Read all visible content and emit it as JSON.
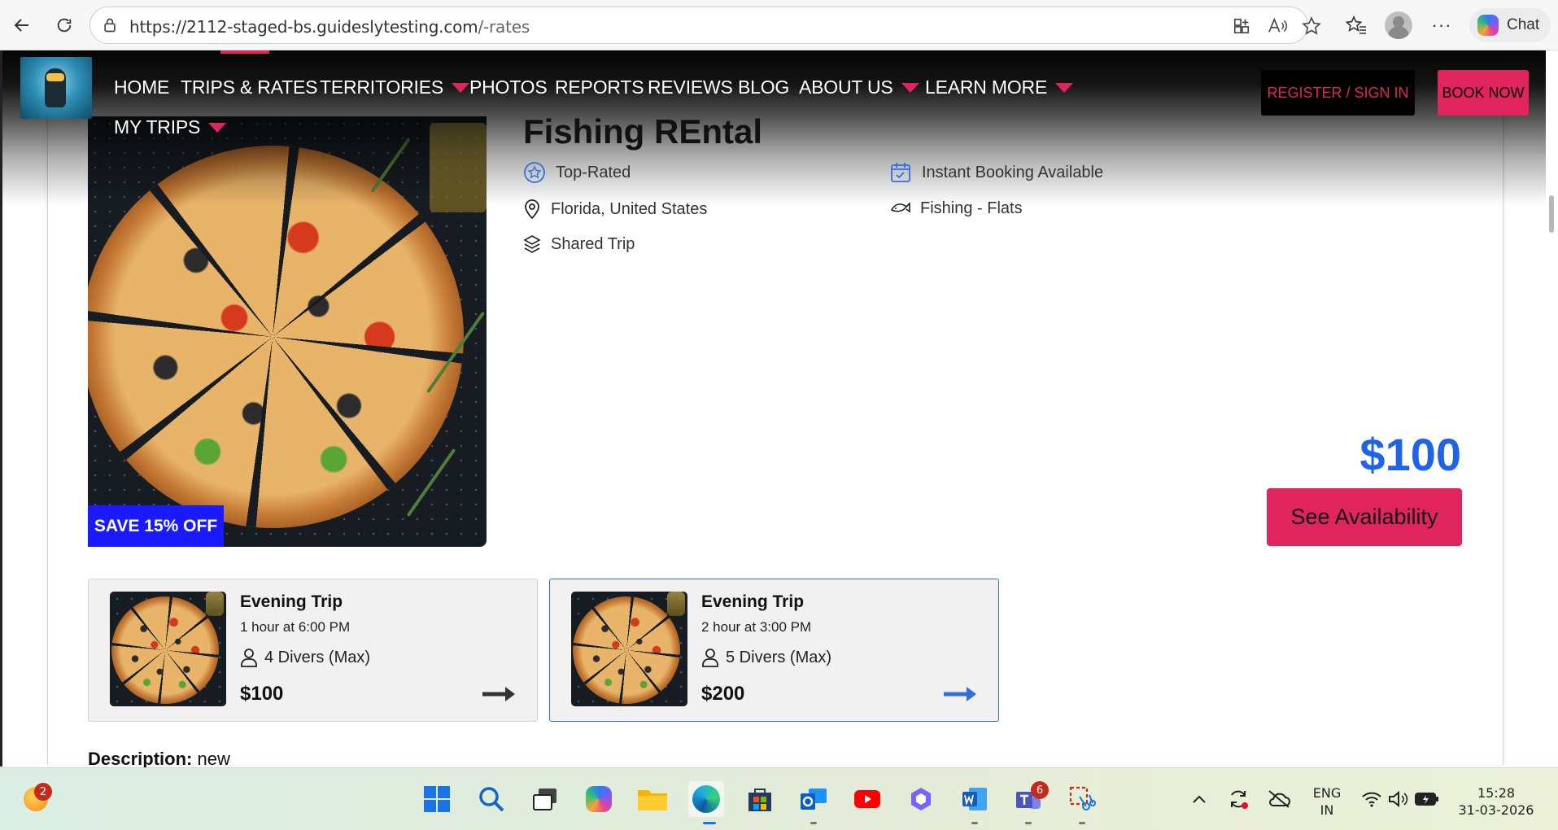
{
  "browser": {
    "url_host": "https://2112-staged-bs.guideslytesting.com",
    "url_path": "/-rates",
    "chat_label": "Chat"
  },
  "site_nav": {
    "items": [
      {
        "label": "HOME"
      },
      {
        "label": "TRIPS & RATES"
      },
      {
        "label": "TERRITORIES"
      },
      {
        "label": "PHOTOS"
      },
      {
        "label": "REPORTS"
      },
      {
        "label": "REVIEWS"
      },
      {
        "label": "BLOG"
      },
      {
        "label": "ABOUT US"
      },
      {
        "label": "LEARN MORE"
      },
      {
        "label": "MY TRIPS"
      }
    ],
    "register_label": "REGISTER / SIGN IN",
    "book_now_label": "BOOK NOW",
    "accent_color": "#e0245e"
  },
  "trip": {
    "title": "Fishing REntal",
    "badge": "SAVE 15% OFF",
    "features": {
      "rating": "Top-Rated",
      "booking": "Instant Booking Available",
      "location": "Florida, United States",
      "category": "Fishing - Flats",
      "trip_type": "Shared Trip"
    },
    "price": "$100",
    "see_availability_label": "See Availability",
    "price_color": "#1e63e9"
  },
  "options": [
    {
      "name": "Evening Trip",
      "time": "1 hour at 6:00 PM",
      "capacity": "4 Divers (Max)",
      "price": "$100",
      "selected": false
    },
    {
      "name": "Evening Trip",
      "time": "2 hour at 3:00 PM",
      "capacity": "5 Divers (Max)",
      "price": "$200",
      "selected": true
    }
  ],
  "description": {
    "label": "Description:",
    "text": "new"
  },
  "taskbar": {
    "widget_badge": "2",
    "teams_badge": "6",
    "language": "ENG",
    "region": "IN",
    "time": "15:28",
    "date": "31-03-2026"
  }
}
